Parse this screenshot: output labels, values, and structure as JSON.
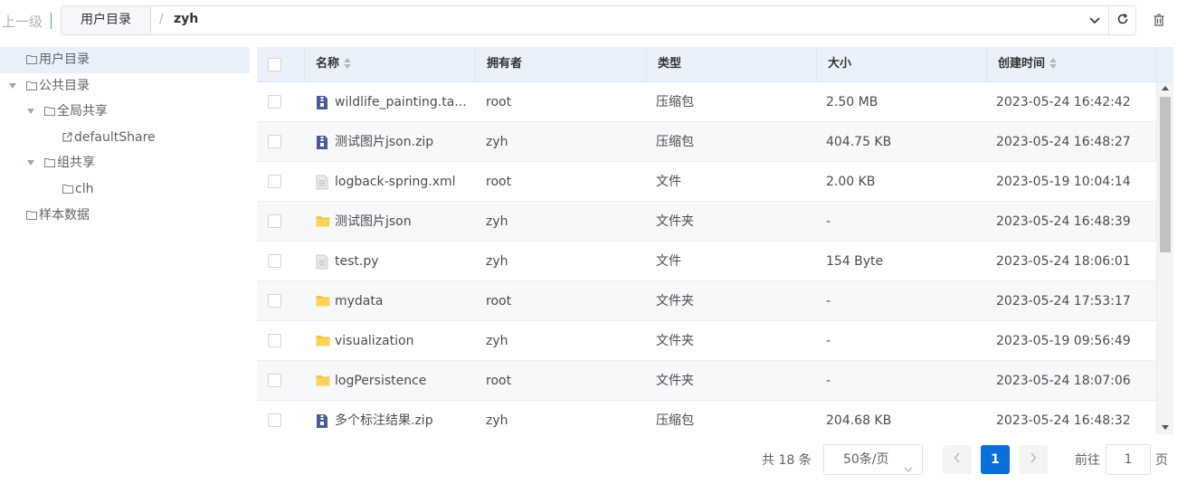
{
  "toolbar": {
    "up_level": "上一级",
    "root_crumb": "用户目录",
    "slash": "/",
    "current_path": "zyh"
  },
  "tree": {
    "items": [
      {
        "label": "用户目录",
        "icon": "folder-icon",
        "selected": true
      },
      {
        "label": "公共目录",
        "icon": "folder-icon",
        "expanded": true
      },
      {
        "label": "全局共享",
        "icon": "folder-icon",
        "expanded": true
      },
      {
        "label": "defaultShare",
        "icon": "external-link-icon"
      },
      {
        "label": "组共享",
        "icon": "folder-icon",
        "expanded": true
      },
      {
        "label": "clh",
        "icon": "folder-icon"
      },
      {
        "label": "样本数据",
        "icon": "folder-icon"
      }
    ]
  },
  "table": {
    "columns": {
      "name": "名称",
      "owner": "拥有者",
      "type": "类型",
      "size": "大小",
      "created": "创建时间"
    },
    "rows": [
      {
        "name": "wildlife_painting.ta...",
        "owner": "root",
        "type": "压缩包",
        "size": "2.50 MB",
        "created": "2023-05-24 16:42:42",
        "icon": "zip-icon"
      },
      {
        "name": "测试图片json.zip",
        "owner": "zyh",
        "type": "压缩包",
        "size": "404.75 KB",
        "created": "2023-05-24 16:48:27",
        "icon": "zip-icon"
      },
      {
        "name": "logback-spring.xml",
        "owner": "root",
        "type": "文件",
        "size": "2.00 KB",
        "created": "2023-05-19 10:04:14",
        "icon": "file-icon"
      },
      {
        "name": "测试图片json",
        "owner": "zyh",
        "type": "文件夹",
        "size": "-",
        "created": "2023-05-24 16:48:39",
        "icon": "folder-icon"
      },
      {
        "name": "test.py",
        "owner": "zyh",
        "type": "文件",
        "size": "154 Byte",
        "created": "2023-05-24 18:06:01",
        "icon": "file-icon"
      },
      {
        "name": "mydata",
        "owner": "root",
        "type": "文件夹",
        "size": "-",
        "created": "2023-05-24 17:53:17",
        "icon": "folder-icon"
      },
      {
        "name": "visualization",
        "owner": "zyh",
        "type": "文件夹",
        "size": "-",
        "created": "2023-05-19 09:56:49",
        "icon": "folder-icon"
      },
      {
        "name": "logPersistence",
        "owner": "root",
        "type": "文件夹",
        "size": "-",
        "created": "2023-05-24 18:07:06",
        "icon": "folder-icon"
      },
      {
        "name": "多个标注结果.zip",
        "owner": "zyh",
        "type": "压缩包",
        "size": "204.68 KB",
        "created": "2023-05-24 16:48:32",
        "icon": "zip-icon"
      }
    ]
  },
  "pagination": {
    "total": "共 18 条",
    "page_size": "50条/页",
    "current_page": "1",
    "goto_label": "前往",
    "goto_value": "1",
    "goto_suffix": "页"
  },
  "colors": {
    "accent": "#0a6fd8",
    "header_bg": "#eaf1fa",
    "selected_tree_bg": "#e8f1fb",
    "folder": "#f8c33a",
    "zip": "#4a5a9c"
  }
}
